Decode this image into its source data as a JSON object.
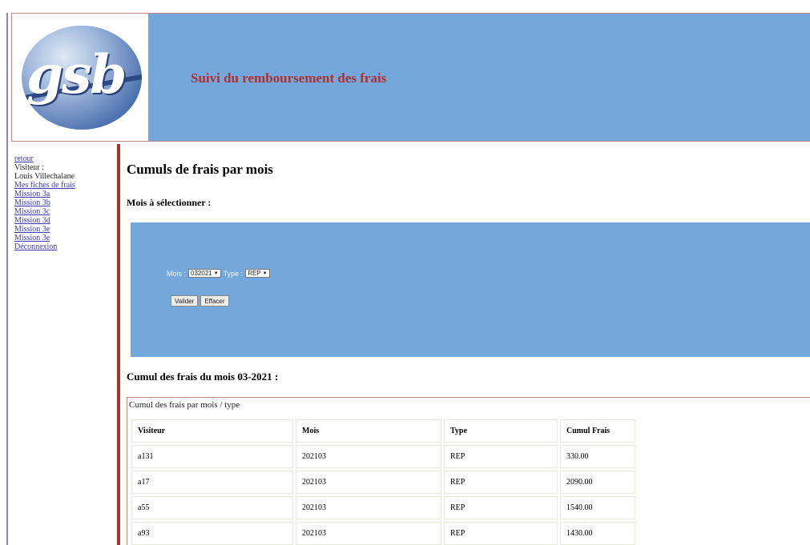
{
  "header": {
    "logo_text": "gsb",
    "title": "Suivi du remboursement des frais"
  },
  "sidebar": {
    "return_link": "retour",
    "visitor_label": "Visiteur :",
    "visitor_name": "Louis Villechalane",
    "items": [
      {
        "label": "Mes fiches de frais"
      },
      {
        "label": "Mission 3a"
      },
      {
        "label": "Mission 3b"
      },
      {
        "label": "Mission 3c"
      },
      {
        "label": "Mission 3d"
      },
      {
        "label": "Mission 3e"
      },
      {
        "label": "Mission 3e"
      },
      {
        "label": "Déconnexion"
      }
    ]
  },
  "main": {
    "title": "Cumuls de frais par mois",
    "month_heading": "Mois à sélectionner :",
    "filter": {
      "month_label": "Mois :",
      "month_value": "032021",
      "type_label": "Type :",
      "type_value": "REP",
      "validate_label": "Valider",
      "clear_label": "Effacer"
    },
    "cumul_heading": "Cumul des frais du mois 03-2021 :",
    "table": {
      "caption": "Cumul des frais par mois / type",
      "headers": [
        "Visiteur",
        "Mois",
        "Type",
        "Cumul Frais"
      ],
      "rows": [
        [
          "a131",
          "202103",
          "REP",
          "330.00"
        ],
        [
          "a17",
          "202103",
          "REP",
          "2090.00"
        ],
        [
          "a55",
          "202103",
          "REP",
          "1540.00"
        ],
        [
          "a93",
          "202103",
          "REP",
          "1430.00"
        ]
      ]
    }
  }
}
